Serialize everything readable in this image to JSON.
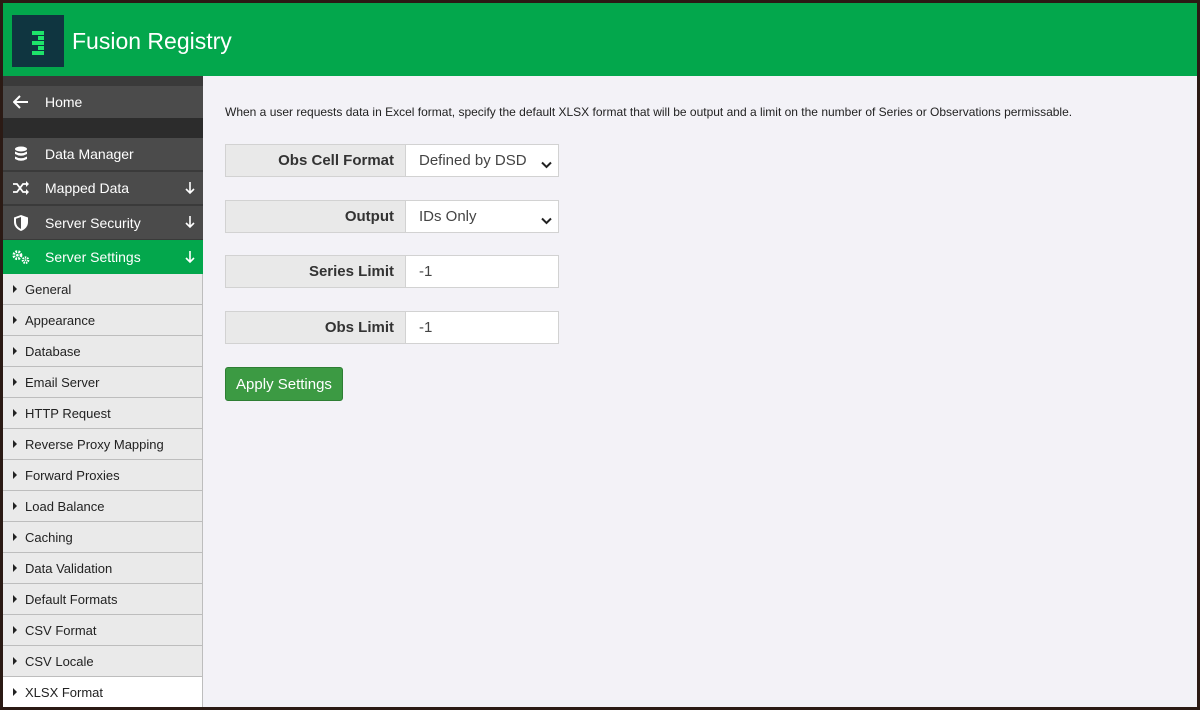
{
  "app": {
    "title": "Fusion Registry",
    "brand_color": "#03a74c"
  },
  "sidebar": {
    "top_items": [
      {
        "label": "Home",
        "icon": "arrow-left-icon"
      },
      {
        "label": "Data Manager",
        "icon": "database-icon"
      },
      {
        "label": "Mapped Data",
        "icon": "shuffle-icon",
        "expand_icon": "arrow-down-icon"
      },
      {
        "label": "Server Security",
        "icon": "shield-icon",
        "expand_icon": "arrow-down-icon"
      },
      {
        "label": "Server Settings",
        "icon": "gears-icon",
        "expand_icon": "arrow-down-icon",
        "active": true
      }
    ],
    "sub_items": [
      "General",
      "Appearance",
      "Database",
      "Email Server",
      "HTTP Request",
      "Reverse Proxy Mapping",
      "Forward Proxies",
      "Load Balance",
      "Caching",
      "Data Validation",
      "Default Formats",
      "CSV Format",
      "CSV Locale",
      "XLSX Format"
    ],
    "active_sub_item": "XLSX Format"
  },
  "main": {
    "description": "When a user requests data in Excel format, specify the default XLSX format that will be output and a limit on the number of Series or Observations permissable.",
    "fields": {
      "obs_cell_format": {
        "label": "Obs Cell Format",
        "value": "Defined by DSD"
      },
      "output": {
        "label": "Output",
        "value": "IDs Only"
      },
      "series_limit": {
        "label": "Series Limit",
        "value": "-1"
      },
      "obs_limit": {
        "label": "Obs Limit",
        "value": "-1"
      }
    },
    "apply_label": "Apply Settings"
  }
}
